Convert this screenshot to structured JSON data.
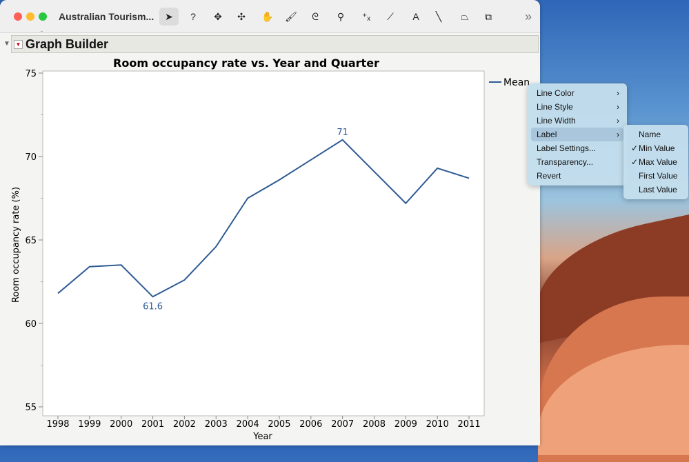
{
  "window": {
    "title": "Australian Tourism...",
    "panel_title": "Graph Builder"
  },
  "toolbar": {
    "tools": [
      "arrow-icon",
      "help-icon",
      "crosshair-icon",
      "move-icon",
      "hand-icon",
      "brush-icon",
      "lasso-icon",
      "magnifier-icon",
      "scaler-icon",
      "ruler-icon",
      "text-annotate-icon",
      "line-icon",
      "polygon-icon",
      "shape-icon"
    ],
    "glyphs": [
      "➤",
      "?",
      "✥",
      "✣",
      "✋",
      "🖌",
      "ᘓ",
      "⚲",
      "⁺ₓ",
      "⟋",
      "A",
      "╲",
      "⏢",
      "⧉"
    ],
    "more": "»"
  },
  "chart_data": {
    "type": "line",
    "title": "Room occupancy rate vs. Year and Quarter",
    "xlabel": "Year",
    "ylabel": "Room occupancy rate (%)",
    "categories": [
      "1998",
      "1999",
      "2000",
      "2001",
      "2002",
      "2003",
      "2004",
      "2005",
      "2006",
      "2007",
      "2008",
      "2009",
      "2010",
      "2011"
    ],
    "series": [
      {
        "name": "Mean",
        "values": [
          61.8,
          63.4,
          63.5,
          61.6,
          62.6,
          64.6,
          67.5,
          68.6,
          69.8,
          71.0,
          69.1,
          67.2,
          69.3,
          68.7
        ],
        "color": "#2e5a94"
      }
    ],
    "ylim": [
      55,
      75
    ],
    "yticks": [
      "55",
      "60",
      "65",
      "70",
      "75"
    ],
    "labels": [
      {
        "index": 3,
        "text": "61.6",
        "position": "below"
      },
      {
        "index": 9,
        "text": "71",
        "position": "above"
      }
    ],
    "legend": "right"
  },
  "context_menu": {
    "items": [
      {
        "label": "Line Color",
        "sub": true
      },
      {
        "label": "Line Style",
        "sub": true
      },
      {
        "label": "Line Width",
        "sub": true
      },
      {
        "label": "Label",
        "sub": true
      },
      {
        "label": "Label Settings...",
        "sub": false
      },
      {
        "label": "Transparency...",
        "sub": false
      },
      {
        "label": "Revert",
        "sub": false
      }
    ],
    "submenu": [
      {
        "label": "Name",
        "checked": false
      },
      {
        "label": "Min Value",
        "checked": true
      },
      {
        "label": "Max Value",
        "checked": true
      },
      {
        "label": "First Value",
        "checked": false
      },
      {
        "label": "Last Value",
        "checked": false
      }
    ],
    "check": "✓",
    "arrow": "›"
  }
}
